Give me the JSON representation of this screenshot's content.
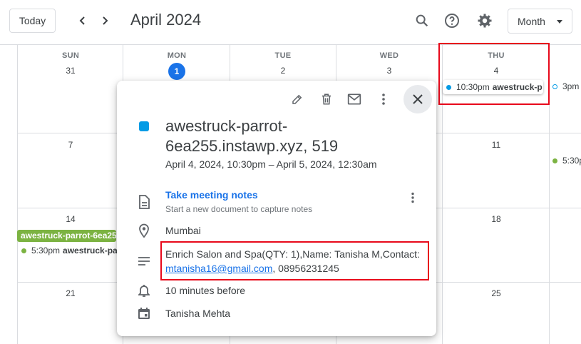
{
  "header": {
    "today_label": "Today",
    "title": "April 2024",
    "view_label": "Month"
  },
  "calendar": {
    "days_of_week": [
      "SUN",
      "MON",
      "TUE",
      "WED",
      "THU"
    ],
    "week1": [
      "31",
      "1",
      "2",
      "3",
      "4"
    ],
    "week2_sun": "7",
    "week2_thu": "11",
    "week3_sun": "14",
    "week3_thu": "18",
    "week4_sun": "21",
    "week4_thu": "25",
    "thu_event_time": "10:30pm",
    "thu_event_title": "awestruck-p",
    "fri_event_time": "3pm",
    "fri_event2_time": "5:30p",
    "sun14_allday": "awestruck-parrot-6ea25",
    "sun14_event_time": "5:30pm",
    "sun14_event_title": "awestruck-pa"
  },
  "popup": {
    "title": "awestruck-parrot-6ea255.instawp.xyz, 519",
    "time": "April 4, 2024, 10:30pm – April 5, 2024, 12:30am",
    "notes_link": "Take meeting notes",
    "notes_sub": "Start a new document to capture notes",
    "location": "Mumbai",
    "description_prefix": "Enrich Salon and Spa(QTY: 1),Name: Tanisha M,Contact:",
    "description_email": "mtanisha16@gmail.com",
    "description_suffix": ", 08956231245",
    "reminder": "10 minutes before",
    "organizer": "Tanisha Mehta",
    "event_color": "#039be5"
  },
  "colors": {
    "accent": "#1a73e8",
    "highlight": "#e8091b",
    "green": "#7cb342"
  },
  "icons": [
    "chevron-left-icon",
    "chevron-right-icon",
    "search-icon",
    "help-icon",
    "settings-icon",
    "edit-icon",
    "delete-icon",
    "mail-icon",
    "more-vert-icon",
    "close-icon",
    "document-icon",
    "location-icon",
    "description-icon",
    "bell-icon",
    "calendar-icon"
  ]
}
